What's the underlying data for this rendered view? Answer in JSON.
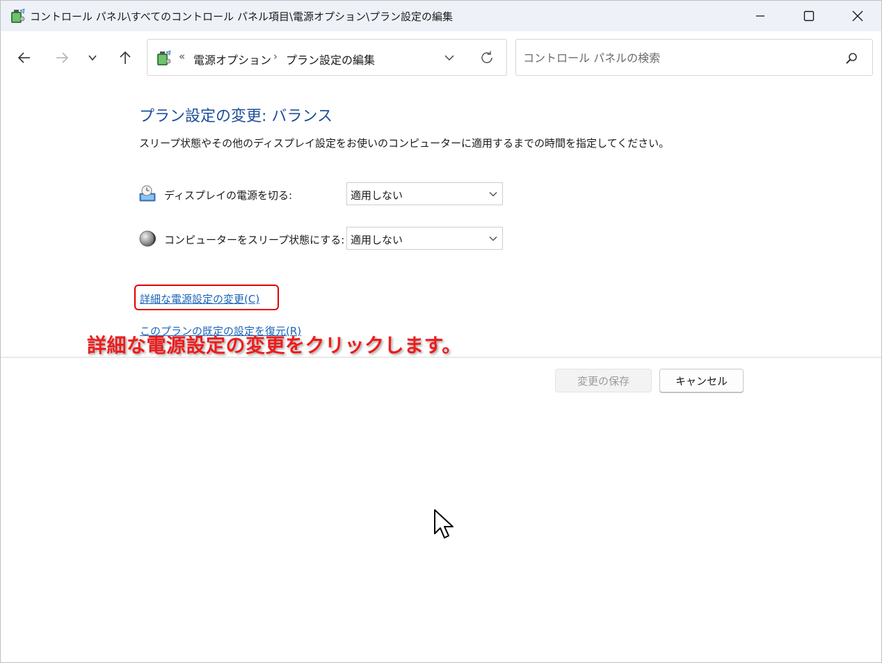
{
  "window": {
    "title": "コントロール パネル\\すべてのコントロール パネル項目\\電源オプション\\プラン設定の編集"
  },
  "nav": {
    "breadcrumb_overflow": "«",
    "breadcrumbs": [
      "電源オプション",
      "プラン設定の編集"
    ],
    "breadcrumb_separator": "›",
    "search_placeholder": "コントロール パネルの検索"
  },
  "main": {
    "heading": "プラン設定の変更: バランス",
    "description": "スリープ状態やその他のディスプレイ設定をお使いのコンピューターに適用するまでの時間を指定してください。",
    "settings": [
      {
        "label": "ディスプレイの電源を切る:",
        "value": "適用しない",
        "icon": "display-power-icon"
      },
      {
        "label": "コンピューターをスリープ状態にする:",
        "value": "適用しない",
        "icon": "sleep-moon-icon"
      }
    ],
    "advanced_link": "詳細な電源設定の変更(C)",
    "restore_link": "このプランの既定の設定を復元(R)",
    "annotation": "詳細な電源設定の変更をクリックします。"
  },
  "footer": {
    "save_label": "変更の保存",
    "cancel_label": "キャンセル"
  },
  "colors": {
    "heading": "#1e4e9a",
    "link": "#1a63b8",
    "annotation": "#ef1c1c",
    "highlight_border": "#e00000",
    "titlebar_bg": "#eef1f7"
  }
}
